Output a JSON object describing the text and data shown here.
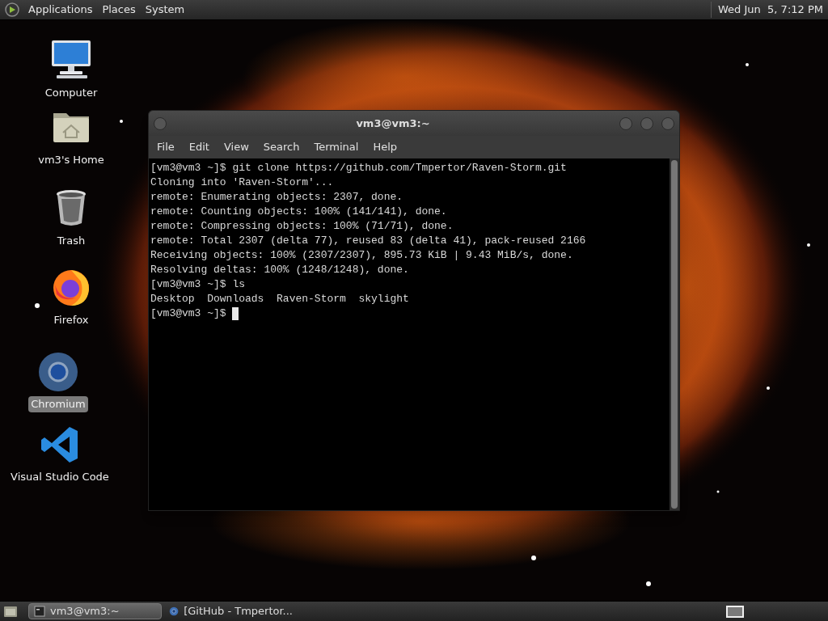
{
  "top_panel": {
    "menus": [
      "Applications",
      "Places",
      "System"
    ],
    "clock": "Wed Jun  5, 7:12 PM"
  },
  "desktop_icons": [
    {
      "kind": "computer",
      "label": "Computer",
      "selected": false
    },
    {
      "kind": "home",
      "label": "vm3's Home",
      "selected": false
    },
    {
      "kind": "trash",
      "label": "Trash",
      "selected": false
    },
    {
      "kind": "firefox",
      "label": "Firefox",
      "selected": false
    },
    {
      "kind": "chromium",
      "label": "Chromium",
      "selected": true
    },
    {
      "kind": "vscode",
      "label": "Visual Studio Code",
      "selected": false
    }
  ],
  "terminal": {
    "title": "vm3@vm3:~",
    "menu": [
      "File",
      "Edit",
      "View",
      "Search",
      "Terminal",
      "Help"
    ],
    "lines": [
      "[vm3@vm3 ~]$ git clone https://github.com/Tmpertor/Raven-Storm.git",
      "Cloning into 'Raven-Storm'...",
      "remote: Enumerating objects: 2307, done.",
      "remote: Counting objects: 100% (141/141), done.",
      "remote: Compressing objects: 100% (71/71), done.",
      "remote: Total 2307 (delta 77), reused 83 (delta 41), pack-reused 2166",
      "Receiving objects: 100% (2307/2307), 895.73 KiB | 9.43 MiB/s, done.",
      "Resolving deltas: 100% (1248/1248), done.",
      "[vm3@vm3 ~]$ ls",
      "Desktop  Downloads  Raven-Storm  skylight",
      "[vm3@vm3 ~]$ "
    ]
  },
  "taskbar": {
    "tasks": [
      {
        "kind": "terminal",
        "label": "vm3@vm3:~",
        "selected": true
      },
      {
        "kind": "browser",
        "label": "[GitHub - Tmpertor...",
        "selected": false
      }
    ]
  }
}
